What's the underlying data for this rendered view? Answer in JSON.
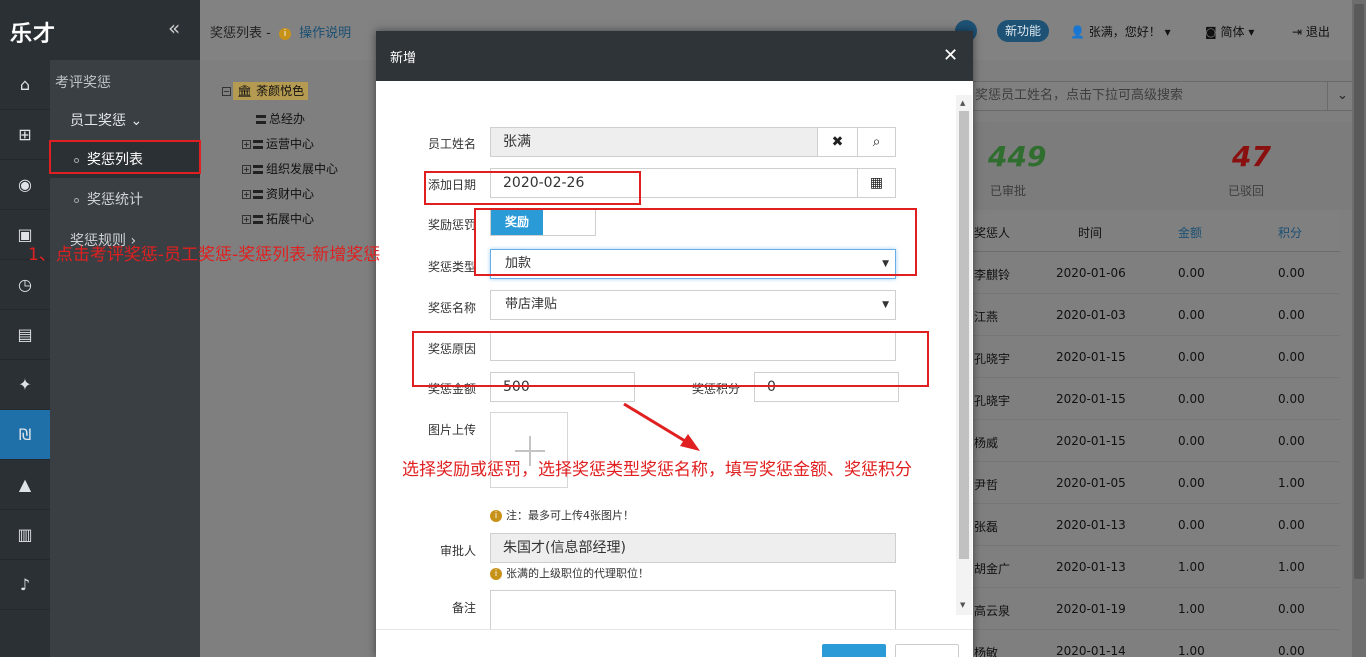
{
  "logo": "乐才",
  "rail_icons": [
    "home-icon",
    "sitemap-icon",
    "user-circle-icon",
    "calendar-check-icon",
    "clock-icon",
    "briefcase-icon",
    "gift-icon",
    "reward-icon",
    "graduation-cap-icon",
    "bar-chart-icon",
    "bell-icon"
  ],
  "sidebar": {
    "category": "考评奖惩",
    "submenu": "员工奖惩",
    "items": [
      "奖惩列表",
      "奖惩统计"
    ],
    "next_menu": "奖惩规则"
  },
  "breadcrumb": {
    "title": "奖惩列表 -",
    "help": "操作说明"
  },
  "topbar": {
    "new_features": "新功能",
    "user": "张满，您好！",
    "language": "简体",
    "logout": "退出"
  },
  "tree": {
    "root": "荼颜悦色",
    "nodes": [
      "总经办",
      "运营中心",
      "组织发展中心",
      "资财中心",
      "拓展中心"
    ]
  },
  "search": {
    "placeholder": "奖惩员工姓名，点击下拉可高级搜索"
  },
  "stats": [
    {
      "value": "449",
      "label": "已审批",
      "color": "#2f6e2f"
    },
    {
      "value": "47",
      "label": "已驳回",
      "color": "#8a1010"
    }
  ],
  "table": {
    "headers": [
      "奖惩人",
      "时间",
      "金额",
      "积分"
    ],
    "rows": [
      [
        "李麒铃",
        "2020-01-06",
        "0.00",
        "0.00"
      ],
      [
        "江燕",
        "2020-01-03",
        "0.00",
        "0.00"
      ],
      [
        "孔晓宇",
        "2020-01-15",
        "0.00",
        "0.00"
      ],
      [
        "孔晓宇",
        "2020-01-15",
        "0.00",
        "0.00"
      ],
      [
        "杨威",
        "2020-01-15",
        "0.00",
        "0.00"
      ],
      [
        "尹哲",
        "2020-01-05",
        "0.00",
        "1.00"
      ],
      [
        "张磊",
        "2020-01-13",
        "0.00",
        "0.00"
      ],
      [
        "胡金广",
        "2020-01-13",
        "1.00",
        "1.00"
      ],
      [
        "高云泉",
        "2020-01-19",
        "1.00",
        "0.00"
      ],
      [
        "杨敏",
        "2020-01-14",
        "1.00",
        "0.00"
      ]
    ]
  },
  "modal": {
    "title": "新增",
    "employee_label": "员工姓名",
    "employee_value": "张满",
    "date_label": "添加日期",
    "date_value": "2020-02-26",
    "reward_punish_label": "奖励惩罚",
    "reward_punish_value": "奖励",
    "type_label": "奖惩类型",
    "type_value": "加款",
    "name_label": "奖惩名称",
    "name_value": "带店津贴",
    "reason_label": "奖惩原因",
    "amount_label": "奖惩金额",
    "amount_value": "500",
    "points_label": "奖惩积分",
    "points_value": "0",
    "upload_label": "图片上传",
    "upload_note": "注：最多可上传4张图片！",
    "approver_label": "审批人",
    "approver_value": "朱国才(信息部经理)",
    "approver_note": "张满的上级职位的代理职位！",
    "remark_label": "备注"
  },
  "annotations": {
    "step1": "1、点击考评奖惩-员工奖惩-奖惩列表-新增奖惩",
    "step2": "选择奖励或惩罚，选择奖惩类型奖惩名称，填写奖惩金额、奖惩积分"
  }
}
